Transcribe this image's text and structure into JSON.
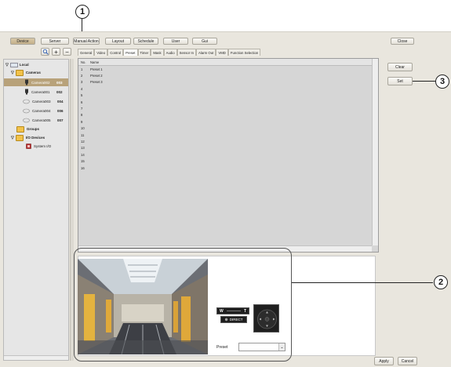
{
  "callouts": {
    "one": "1",
    "two": "2",
    "three": "3"
  },
  "toolbar": {
    "device": "Device",
    "server": "Server",
    "manual_action": "Manual Action",
    "layout": "Layout",
    "schedule": "Schedule",
    "user": "User",
    "gui": "Gui",
    "close": "Close"
  },
  "tree": {
    "local": "Local",
    "cameras": "Cameras",
    "camera_items": [
      {
        "name": "Camera002",
        "id": "003"
      },
      {
        "name": "Camera001",
        "id": "002"
      },
      {
        "name": "Camera003",
        "id": "004"
      },
      {
        "name": "Camera004",
        "id": "006"
      },
      {
        "name": "Camera005",
        "id": "007"
      }
    ],
    "groups": "Groups",
    "io_devices": "I/O Devices",
    "system_io": "System I/O"
  },
  "tabs": [
    "General",
    "Video",
    "Control",
    "Preset",
    "Timer",
    "Mask",
    "Audio",
    "Sensor In",
    "Alarm Out",
    "VMD",
    "Function Selection"
  ],
  "preset_table": {
    "header_no": "No.",
    "header_name": "Name",
    "rows": [
      {
        "no": "1",
        "name": "Preset 1"
      },
      {
        "no": "2",
        "name": "Preset 2"
      },
      {
        "no": "3",
        "name": "Preset 3"
      },
      {
        "no": "4",
        "name": ""
      },
      {
        "no": "5",
        "name": ""
      },
      {
        "no": "6",
        "name": ""
      },
      {
        "no": "7",
        "name": ""
      },
      {
        "no": "8",
        "name": ""
      },
      {
        "no": "9",
        "name": ""
      },
      {
        "no": "10",
        "name": ""
      },
      {
        "no": "11",
        "name": ""
      },
      {
        "no": "12",
        "name": ""
      },
      {
        "no": "13",
        "name": ""
      },
      {
        "no": "14",
        "name": ""
      },
      {
        "no": "15",
        "name": ""
      },
      {
        "no": "16",
        "name": ""
      }
    ]
  },
  "side_buttons": {
    "clear": "Clear",
    "set": "Set"
  },
  "ptz": {
    "wide": "W",
    "tele": "T",
    "direct": "DIRECT",
    "preset_label": "Preset"
  },
  "footer": {
    "apply": "Apply",
    "cancel": "Cancel"
  }
}
